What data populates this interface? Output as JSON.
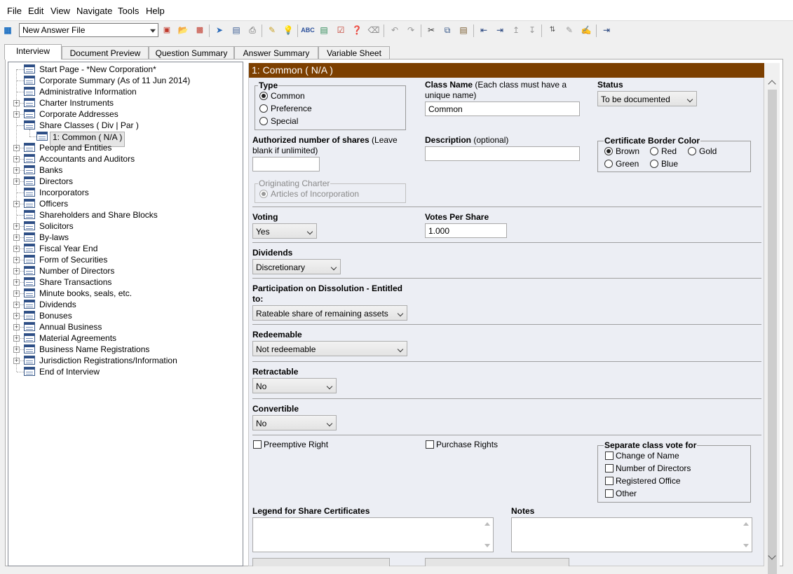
{
  "menu": [
    "File",
    "Edit",
    "View",
    "Navigate",
    "Tools",
    "Help"
  ],
  "toolbar": {
    "answer_file": "New Answer File",
    "icons": [
      "app-icon",
      "new-answer-icon",
      "open-icon",
      "save-as-icon",
      "next-icon",
      "save-icon",
      "print-icon",
      "properties-icon",
      "tip-icon",
      "spell-check-icon",
      "export-icon",
      "check-icon",
      "help-icon",
      "clear-icon",
      "undo-icon",
      "redo-icon",
      "cut-icon",
      "copy-icon",
      "paste-icon",
      "insert-icon",
      "add-after-icon",
      "move-up-icon",
      "move-down-icon",
      "sort-icon",
      "edit-icon",
      "rename-icon",
      "finish-icon"
    ]
  },
  "tabs": [
    "Interview",
    "Document Preview",
    "Question Summary",
    "Answer Summary",
    "Variable Sheet"
  ],
  "tree": [
    {
      "label": "Start Page - *New Corporation*",
      "exp": false,
      "level": 0
    },
    {
      "label": "Corporate Summary (As of 11 Jun 2014)",
      "exp": false,
      "level": 0
    },
    {
      "label": "Administrative Information",
      "exp": false,
      "level": 0
    },
    {
      "label": "Charter Instruments",
      "exp": true,
      "level": 0
    },
    {
      "label": "Corporate Addresses",
      "exp": true,
      "level": 0
    },
    {
      "label": "Share Classes ( Div | Par )",
      "exp": false,
      "level": 0
    },
    {
      "label": "1: Common ( N/A )",
      "exp": false,
      "level": 1,
      "selected": true
    },
    {
      "label": "People and Entities",
      "exp": true,
      "level": 0
    },
    {
      "label": "Accountants and Auditors",
      "exp": true,
      "level": 0
    },
    {
      "label": "Banks",
      "exp": true,
      "level": 0
    },
    {
      "label": "Directors",
      "exp": true,
      "level": 0
    },
    {
      "label": "Incorporators",
      "exp": false,
      "level": 0
    },
    {
      "label": "Officers",
      "exp": true,
      "level": 0
    },
    {
      "label": "Shareholders and Share Blocks",
      "exp": false,
      "level": 0
    },
    {
      "label": "Solicitors",
      "exp": true,
      "level": 0
    },
    {
      "label": "By-laws",
      "exp": true,
      "level": 0
    },
    {
      "label": "Fiscal Year End",
      "exp": true,
      "level": 0
    },
    {
      "label": "Form of Securities",
      "exp": true,
      "level": 0
    },
    {
      "label": "Number of Directors",
      "exp": true,
      "level": 0
    },
    {
      "label": "Share Transactions",
      "exp": true,
      "level": 0
    },
    {
      "label": "Minute books, seals, etc.",
      "exp": true,
      "level": 0
    },
    {
      "label": "Dividends",
      "exp": true,
      "level": 0
    },
    {
      "label": "Bonuses",
      "exp": true,
      "level": 0
    },
    {
      "label": "Annual Business",
      "exp": true,
      "level": 0
    },
    {
      "label": "Material Agreements",
      "exp": true,
      "level": 0
    },
    {
      "label": "Business Name Registrations",
      "exp": true,
      "level": 0
    },
    {
      "label": "Jurisdiction Registrations/Information",
      "exp": true,
      "level": 0
    },
    {
      "label": "End of Interview",
      "exp": false,
      "level": 0
    }
  ],
  "form": {
    "header": "1: Common ( N/A )",
    "type_label": "Type",
    "type_options": [
      "Common",
      "Preference",
      "Special"
    ],
    "class_name_label": "Class Name",
    "class_name_hint": " (Each class must have a unique name)",
    "class_name_value": "Common",
    "status_label": "Status",
    "status_value": "To be documented",
    "auth_label": "Authorized number of shares",
    "auth_hint": " (Leave blank if unlimited)",
    "auth_value": "",
    "desc_label": "Description",
    "desc_hint": " (optional)",
    "desc_value": "",
    "border_label": "Certificate Border Color",
    "border_options": [
      "Brown",
      "Red",
      "Gold",
      "Green",
      "Blue"
    ],
    "charter_label": "Originating Charter",
    "charter_value": "Articles of Incorporation",
    "voting_label": "Voting",
    "voting_value": "Yes",
    "votes_label": "Votes Per Share",
    "votes_value": "1.000",
    "dividends_label": "Dividends",
    "dividends_value": "Discretionary",
    "dissolution_label": "Participation on Dissolution - Entitled to:",
    "dissolution_value": "Rateable share of remaining assets",
    "redeemable_label": "Redeemable",
    "redeemable_value": "Not redeemable",
    "retractable_label": "Retractable",
    "retractable_value": "No",
    "convertible_label": "Convertible",
    "convertible_value": "No",
    "preemptive_label": "Preemptive Right",
    "purchase_label": "Purchase Rights",
    "sepvote_label": "Separate class vote for",
    "sepvote_options": [
      "Change of Name",
      "Number of Directors",
      "Registered Office",
      "Other"
    ],
    "legend_label": "Legend for Share Certificates",
    "notes_label": "Notes"
  }
}
